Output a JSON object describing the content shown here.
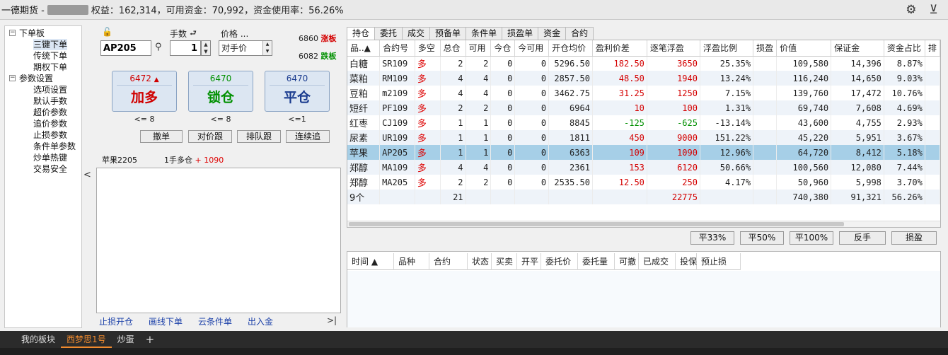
{
  "title": {
    "broker": "一德期货 -",
    "stats": "权益：162,314，可用资金：70,992，资金使用率：56.26%"
  },
  "tree": {
    "items": [
      {
        "label": "下单板",
        "level": 0,
        "expand": "−"
      },
      {
        "label": "三键下单",
        "level": 1
      },
      {
        "label": "传统下单",
        "level": 1
      },
      {
        "label": "期权下单",
        "level": 1
      },
      {
        "label": "参数设置",
        "level": 0,
        "expand": "−"
      },
      {
        "label": "选项设置",
        "level": 1
      },
      {
        "label": "默认手数",
        "level": 1
      },
      {
        "label": "超价参数",
        "level": 1
      },
      {
        "label": "追价参数",
        "level": 1
      },
      {
        "label": "止损参数",
        "level": 1
      },
      {
        "label": "条件单参数",
        "level": 1
      },
      {
        "label": "炒单热键",
        "level": 1
      },
      {
        "label": "交易安全",
        "level": 1
      }
    ]
  },
  "order": {
    "lots_label": "手数",
    "price_label": "价格 ...",
    "code": "AP205",
    "qty": "1",
    "price_type": "对手价",
    "limit_up_value": "6860",
    "limit_up_tag": "涨板",
    "limit_down_value": "6082",
    "limit_down_tag": "跌板",
    "buttons": [
      {
        "price": "6472",
        "action": "加多",
        "sub": "<= 8",
        "color": "#d00000",
        "arrow": "▲"
      },
      {
        "price": "6470",
        "action": "锁仓",
        "sub": "<= 8",
        "color": "#009000",
        "arrow": ""
      },
      {
        "price": "6470",
        "action": "平仓",
        "sub": "<=1",
        "color": "#1b3c8f",
        "arrow": ""
      }
    ],
    "small_buttons": [
      "撤单",
      "对价跟",
      "排队跟",
      "连续追"
    ],
    "position_name": "苹果2205",
    "position_desc": "1手多仓",
    "position_pnl": "+ 1090",
    "links": [
      "止损开仓",
      "画线下单",
      "云条件单",
      "出入金"
    ],
    "links_end": ">|"
  },
  "tabs": [
    "持仓",
    "委托",
    "成交",
    "预备单",
    "条件单",
    "损盈单",
    "资金",
    "合约"
  ],
  "positions": {
    "headers": [
      "品..▲",
      "合约号",
      "多空",
      "总仓",
      "可用",
      "今仓",
      "今可用",
      "开仓均价",
      "盈利价差",
      "逐笔浮盈",
      "浮盈比例",
      "损盈",
      "价值",
      "保证金",
      "资金占比",
      "排"
    ],
    "rows": [
      [
        "白糖",
        "SR109",
        "多",
        "2",
        "2",
        "0",
        "0",
        "5296.50",
        "182.50",
        "3650",
        "25.35%",
        "",
        "109,580",
        "14,396",
        "8.87%"
      ],
      [
        "菜粕",
        "RM109",
        "多",
        "4",
        "4",
        "0",
        "0",
        "2857.50",
        "48.50",
        "1940",
        "13.24%",
        "",
        "116,240",
        "14,650",
        "9.03%"
      ],
      [
        "豆粕",
        "m2109",
        "多",
        "4",
        "4",
        "0",
        "0",
        "3462.75",
        "31.25",
        "1250",
        "7.15%",
        "",
        "139,760",
        "17,472",
        "10.76%"
      ],
      [
        "短纤",
        "PF109",
        "多",
        "2",
        "2",
        "0",
        "0",
        "6964",
        "10",
        "100",
        "1.31%",
        "",
        "69,740",
        "7,608",
        "4.69%"
      ],
      [
        "红枣",
        "CJ109",
        "多",
        "1",
        "1",
        "0",
        "0",
        "8845",
        "-125",
        "-625",
        "-13.14%",
        "",
        "43,600",
        "4,755",
        "2.93%"
      ],
      [
        "尿素",
        "UR109",
        "多",
        "1",
        "1",
        "0",
        "0",
        "1811",
        "450",
        "9000",
        "151.22%",
        "",
        "45,220",
        "5,951",
        "3.67%"
      ],
      [
        "苹果",
        "AP205",
        "多",
        "1",
        "1",
        "0",
        "0",
        "6363",
        "109",
        "1090",
        "12.96%",
        "",
        "64,720",
        "8,412",
        "5.18%"
      ],
      [
        "郑醇",
        "MA109",
        "多",
        "4",
        "4",
        "0",
        "0",
        "2361",
        "153",
        "6120",
        "50.66%",
        "",
        "100,560",
        "12,080",
        "7.44%"
      ],
      [
        "郑醇",
        "MA205",
        "多",
        "2",
        "2",
        "0",
        "0",
        "2535.50",
        "12.50",
        "250",
        "4.17%",
        "",
        "50,960",
        "5,998",
        "3.70%"
      ]
    ],
    "total": [
      "9个",
      "",
      "",
      "21",
      "",
      "",
      "",
      "",
      "",
      "22775",
      "",
      "",
      "740,380",
      "91,321",
      "56.26%"
    ],
    "selected_index": 6
  },
  "action_buttons": [
    "平33%",
    "平50%",
    "平100%",
    "反手",
    "损盈"
  ],
  "orders": {
    "headers": [
      "时间 ▲",
      "品种",
      "合约",
      "状态",
      "买卖",
      "开平",
      "委托价",
      "委托量",
      "可撤",
      "已成交",
      "投保",
      "预止损"
    ]
  },
  "bottom_tabs": [
    "我的板块",
    "西梦思1号",
    "炒蛋"
  ],
  "bottom_plus": "+",
  "colors": {
    "up": "#d40000",
    "down": "#009000",
    "selected_row": "#a6cfe7",
    "active_tab": "#f08a2e"
  }
}
